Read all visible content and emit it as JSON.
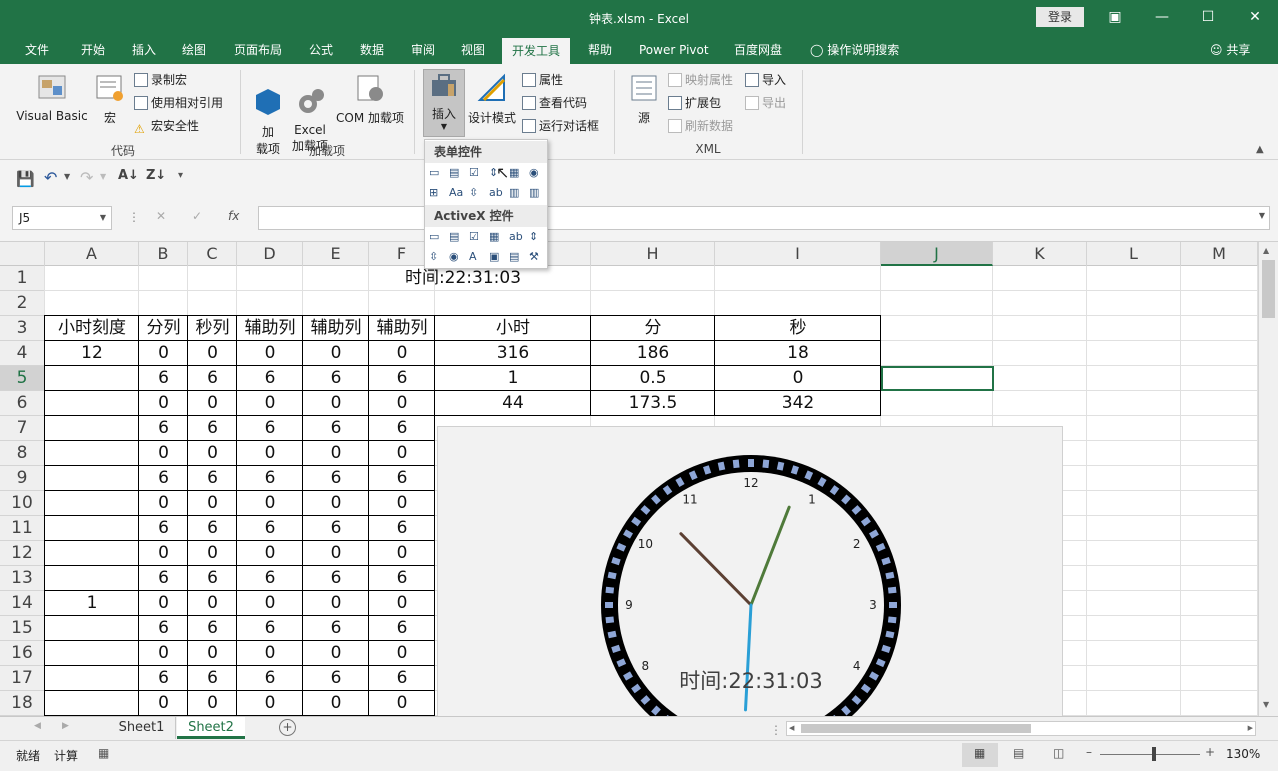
{
  "window": {
    "title": "钟表.xlsm  -  Excel",
    "login": "登录"
  },
  "ribbon_tabs": [
    {
      "label": "文件"
    },
    {
      "label": "开始"
    },
    {
      "label": "插入"
    },
    {
      "label": "绘图"
    },
    {
      "label": "页面布局"
    },
    {
      "label": "公式"
    },
    {
      "label": "数据"
    },
    {
      "label": "审阅"
    },
    {
      "label": "视图"
    },
    {
      "label": "开发工具"
    },
    {
      "label": "帮助"
    },
    {
      "label": "Power Pivot"
    },
    {
      "label": "百度网盘"
    },
    {
      "label": "操作说明搜索"
    },
    {
      "label": "共享"
    }
  ],
  "ribbon": {
    "code": {
      "visual_basic": "Visual Basic",
      "macro": "宏",
      "record_macro": "录制宏",
      "relative_ref": "使用相对引用",
      "macro_security": "宏安全性",
      "label": "代码"
    },
    "addins": {
      "addin": "加\n载项",
      "excel_addin": "Excel\n加载项",
      "com_addin": "COM 加载项",
      "label": "加载项"
    },
    "controls": {
      "insert": "插入",
      "design_mode": "设计模式",
      "properties": "属性",
      "view_code": "查看代码",
      "run_dialog": "运行对话框"
    },
    "xml": {
      "source": "源",
      "map_properties": "映射属性",
      "expansion_packs": "扩展包",
      "refresh_data": "刷新数据",
      "import": "导入",
      "export": "导出",
      "label": "XML"
    }
  },
  "dropdown": {
    "form_controls": "表单控件",
    "activex_controls": "ActiveX 控件"
  },
  "formula_bar": {
    "name_box": "J5",
    "fx": "fx"
  },
  "columns": [
    "A",
    "B",
    "C",
    "D",
    "E",
    "F",
    "G",
    "H",
    "I",
    "J",
    "K",
    "L",
    "M"
  ],
  "rows": [
    "1",
    "2",
    "3",
    "4",
    "5",
    "6",
    "7",
    "8",
    "9",
    "10",
    "11",
    "12",
    "13",
    "14",
    "15",
    "16",
    "17",
    "18"
  ],
  "cells": {
    "title": "时间:22:31:03",
    "headers": [
      "小时刻度",
      "分列",
      "秒列",
      "辅助列",
      "辅助列",
      "辅助列",
      "小时",
      "分",
      "秒"
    ],
    "r4": [
      "12",
      "0",
      "0",
      "0",
      "0",
      "0",
      "316",
      "186",
      "18"
    ],
    "r5": [
      "",
      "6",
      "6",
      "6",
      "6",
      "6",
      "1",
      "0.5",
      "0"
    ],
    "r6": [
      "",
      "0",
      "0",
      "0",
      "0",
      "0",
      "44",
      "173.5",
      "342"
    ],
    "r7": [
      "",
      "6",
      "6",
      "6",
      "6",
      "6"
    ],
    "r8": [
      "",
      "0",
      "0",
      "0",
      "0",
      "0"
    ],
    "r9": [
      "",
      "6",
      "6",
      "6",
      "6",
      "6"
    ],
    "r10": [
      "",
      "0",
      "0",
      "0",
      "0",
      "0"
    ],
    "r11": [
      "",
      "6",
      "6",
      "6",
      "6",
      "6"
    ],
    "r12": [
      "",
      "0",
      "0",
      "0",
      "0",
      "0"
    ],
    "r13": [
      "",
      "6",
      "6",
      "6",
      "6",
      "6"
    ],
    "r14": [
      "1",
      "0",
      "0",
      "0",
      "0",
      "0"
    ],
    "r15": [
      "",
      "6",
      "6",
      "6",
      "6",
      "6"
    ],
    "r16": [
      "",
      "0",
      "0",
      "0",
      "0",
      "0"
    ],
    "r17": [
      "",
      "6",
      "6",
      "6",
      "6",
      "6"
    ],
    "r18": [
      "",
      "0",
      "0",
      "0",
      "0",
      "0"
    ]
  },
  "clock": {
    "caption": "时间:22:31:03",
    "numbers": [
      "12",
      "1",
      "2",
      "3",
      "4",
      "8",
      "9",
      "10",
      "11"
    ],
    "hour": 22,
    "minute": 31,
    "second": 3,
    "colors": {
      "ring": "#8ea6d6",
      "hour_hand": "#5c4033",
      "minute_hand": "#4f7a3a",
      "second_hand": "#2a9fd6"
    }
  },
  "sheets": [
    {
      "name": "Sheet1"
    },
    {
      "name": "Sheet2"
    }
  ],
  "status": {
    "ready": "就绪",
    "calc": "计算",
    "zoom": "130%"
  },
  "theme": {
    "accent": "#217346"
  }
}
